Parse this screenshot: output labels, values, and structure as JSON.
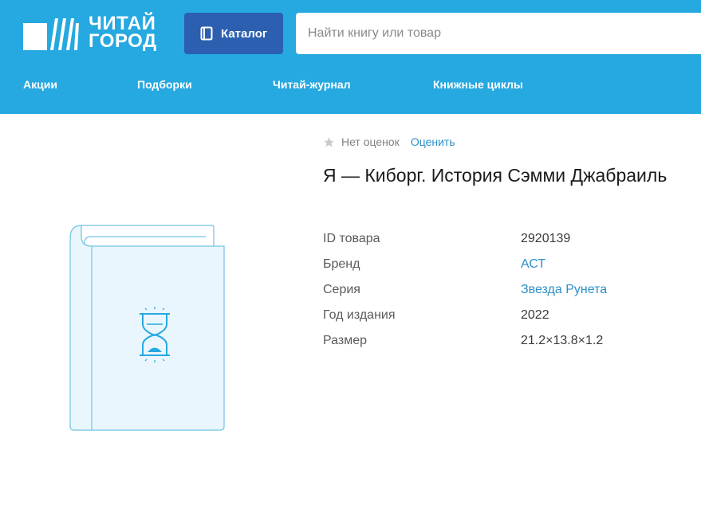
{
  "header": {
    "logo": {
      "line1": "ЧИТАЙ",
      "line2": "ГОРОД"
    },
    "catalog_label": "Каталог",
    "search_placeholder": "Найти книгу или товар",
    "nav": [
      {
        "label": "Акции"
      },
      {
        "label": "Подборки"
      },
      {
        "label": "Читай-журнал"
      },
      {
        "label": "Книжные циклы"
      }
    ]
  },
  "product": {
    "rating": {
      "no_rating_label": "Нет оценок",
      "rate_label": "Оценить"
    },
    "title": "Я — Киборг. История Сэмми Джабраиль",
    "properties": [
      {
        "label": "ID товара",
        "value": "2920139",
        "link": false
      },
      {
        "label": "Бренд",
        "value": "АСТ",
        "link": true
      },
      {
        "label": "Серия",
        "value": "Звезда Рунета",
        "link": true
      },
      {
        "label": "Год издания",
        "value": "2022",
        "link": false
      },
      {
        "label": "Размер",
        "value": "21.2×13.8×1.2",
        "link": false
      }
    ]
  },
  "colors": {
    "header_bg": "#26a8e0",
    "catalog_btn_bg": "#2c5fb0",
    "link": "#2d8fc7"
  }
}
